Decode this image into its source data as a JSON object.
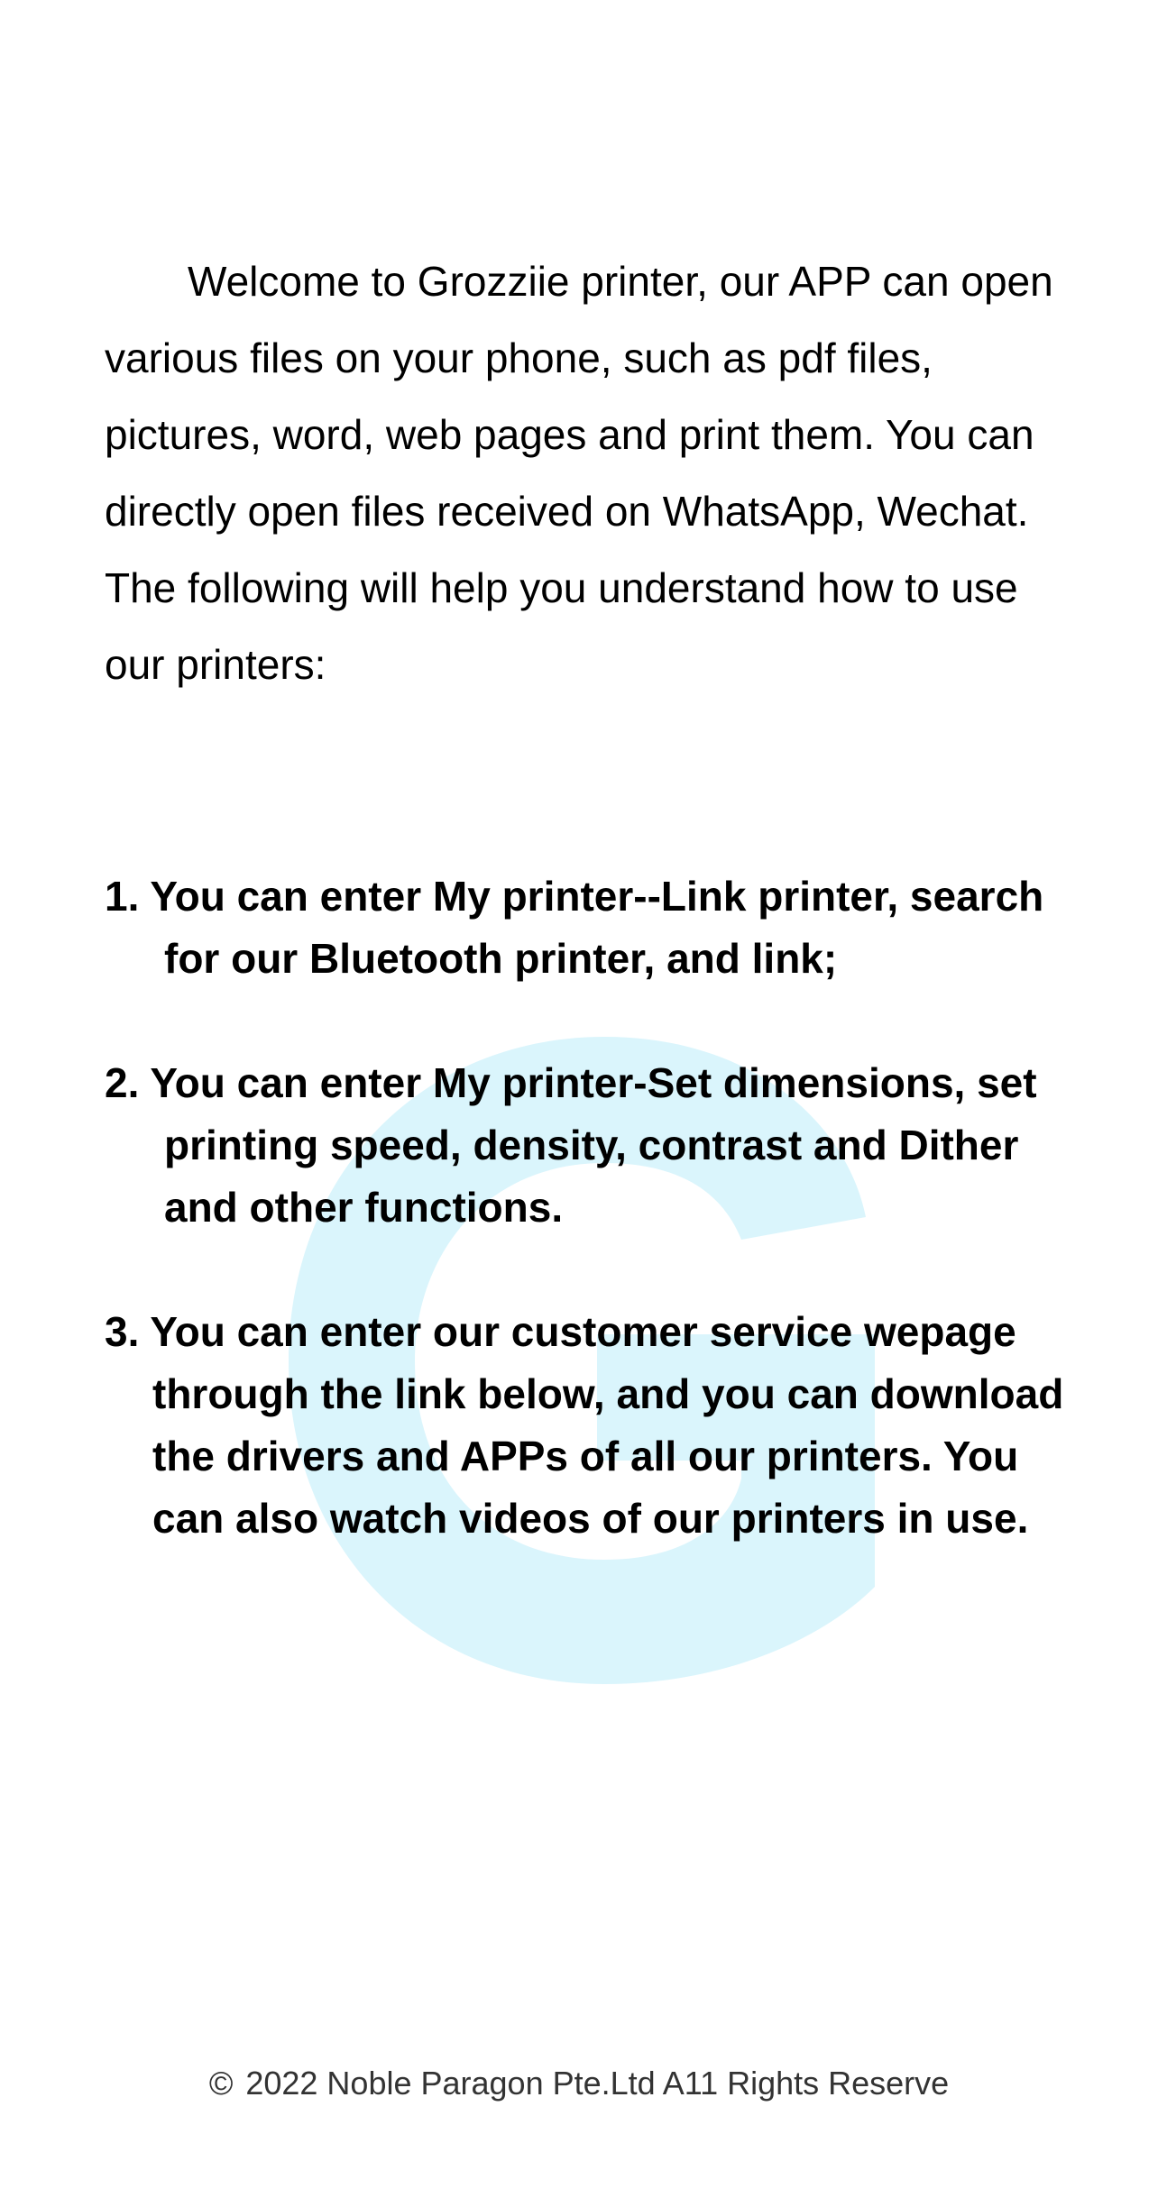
{
  "intro": {
    "paragraph1": "Welcome to Grozziie printer, our APP can open various files on your phone, such as pdf files, pictures, word, web pages and print them. You can directly open files received on WhatsApp, Wechat.",
    "paragraph2": "The following will help you understand how to use our printers:"
  },
  "steps": [
    {
      "number": "1.",
      "text": "You can enter My printer--Link printer, search for our Bluetooth printer, and link;"
    },
    {
      "number": "2.",
      "text": "You can enter My printer-Set dimensions, set printing speed, density, contrast and Dither and other functions."
    },
    {
      "number": "3.",
      "text": "You can enter our customer service wepage through the link below, and you can download the drivers and APPs of all our printers. You can also watch videos of our printers in use."
    }
  ],
  "footer": {
    "copyright_symbol": "©",
    "text": "2022 Noble Paragon Pte.Ltd A11 Rights Reserve"
  },
  "colors": {
    "watermark": "#daf5fc",
    "text": "#000000",
    "footer_text": "#333333"
  },
  "watermark_icon": "grozziie-g-logo-icon"
}
